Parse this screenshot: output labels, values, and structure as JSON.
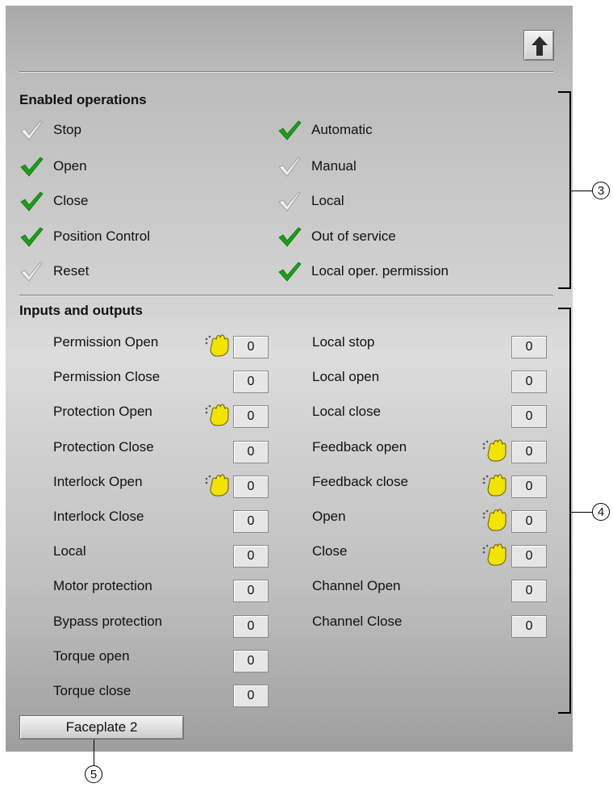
{
  "enabled_operations": {
    "heading": "Enabled operations",
    "left": [
      {
        "label": "Stop",
        "enabled": false
      },
      {
        "label": "Open",
        "enabled": true
      },
      {
        "label": "Close",
        "enabled": true
      },
      {
        "label": "Position Control",
        "enabled": true
      },
      {
        "label": "Reset",
        "enabled": false
      }
    ],
    "right": [
      {
        "label": "Automatic",
        "enabled": true
      },
      {
        "label": "Manual",
        "enabled": false
      },
      {
        "label": "Local",
        "enabled": false
      },
      {
        "label": "Out of service",
        "enabled": true
      },
      {
        "label": "Local oper. permission",
        "enabled": true
      }
    ]
  },
  "inputs_outputs": {
    "heading": "Inputs and outputs",
    "left": [
      {
        "label": "Permission Open",
        "value": "0",
        "simulated": true
      },
      {
        "label": "Permission Close",
        "value": "0",
        "simulated": false
      },
      {
        "label": "Protection Open",
        "value": "0",
        "simulated": true
      },
      {
        "label": "Protection Close",
        "value": "0",
        "simulated": false
      },
      {
        "label": "Interlock Open",
        "value": "0",
        "simulated": true
      },
      {
        "label": "Interlock Close",
        "value": "0",
        "simulated": false
      },
      {
        "label": "Local",
        "value": "0",
        "simulated": false
      },
      {
        "label": "Motor protection",
        "value": "0",
        "simulated": false
      },
      {
        "label": "Bypass protection",
        "value": "0",
        "simulated": false
      },
      {
        "label": "Torque open",
        "value": "0",
        "simulated": false
      },
      {
        "label": "Torque close",
        "value": "0",
        "simulated": false
      }
    ],
    "right": [
      {
        "label": "Local stop",
        "value": "0",
        "simulated": false
      },
      {
        "label": "Local open",
        "value": "0",
        "simulated": false
      },
      {
        "label": "Local close",
        "value": "0",
        "simulated": false
      },
      {
        "label": "Feedback open",
        "value": "0",
        "simulated": true
      },
      {
        "label": "Feedback close",
        "value": "0",
        "simulated": true
      },
      {
        "label": "Open",
        "value": "0",
        "simulated": true
      },
      {
        "label": "Close",
        "value": "0",
        "simulated": true
      },
      {
        "label": "Channel Open",
        "value": "0",
        "simulated": false
      },
      {
        "label": "Channel Close",
        "value": "0",
        "simulated": false
      }
    ]
  },
  "faceplate_button": "Faceplate 2",
  "callouts": {
    "c3": "3",
    "c4": "4",
    "c5": "5"
  },
  "icons": {
    "up": "arrow-up-icon",
    "check_enabled": "green-check-icon",
    "check_disabled": "gray-check-icon",
    "simulation": "hand-icon"
  },
  "colors": {
    "check_enabled": "#1aa01a",
    "check_disabled": "#a8a8a8",
    "hand": "#f0e400"
  }
}
